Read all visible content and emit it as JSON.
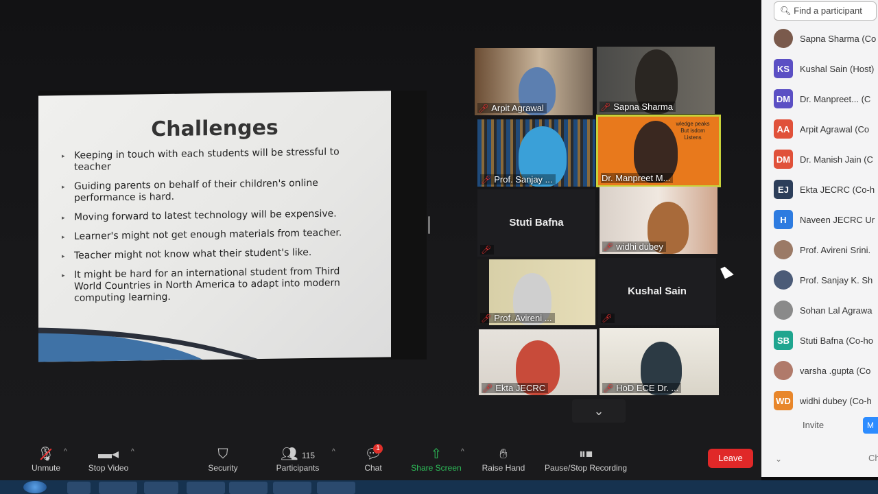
{
  "slide": {
    "title": "Challenges",
    "bullets": [
      "Keeping in touch with each students will be stressful to teacher",
      "Guiding parents on behalf of their children's online performance is hard.",
      "Moving forward to latest technology will be expensive.",
      "Learner's might not get enough materials from teacher.",
      "Teacher might not know what their student's like.",
      "It might be hard for an international student from Third World Countries in North America to adapt into modern computing learning."
    ]
  },
  "tiles": [
    {
      "name": "Arpit Agrawal",
      "video": true
    },
    {
      "name": "Sapna Sharma",
      "video": true
    },
    {
      "name": "Prof. Sanjay ...",
      "video": true
    },
    {
      "name": "Dr. Manpreet M...",
      "video": true,
      "active": true,
      "bg_text": "wledge peaks But isdom Listens"
    },
    {
      "name": "Stuti Bafna",
      "video": false
    },
    {
      "name": "widhi dubey",
      "video": true
    },
    {
      "name": "Prof. Avireni ...",
      "video": true
    },
    {
      "name": "Kushal Sain",
      "video": false
    },
    {
      "name": "Ekta JECRC",
      "video": true
    },
    {
      "name": "HoD ECE Dr. ...",
      "video": true
    }
  ],
  "panel": {
    "search_placeholder": "Find a participant",
    "participants": [
      {
        "initials": "",
        "name": "Sapna Sharma (Co",
        "color": "#7a5a4c",
        "photo": true
      },
      {
        "initials": "KS",
        "name": "Kushal Sain (Host)",
        "color": "#5b4fc4"
      },
      {
        "initials": "DM",
        "name": "Dr. Manpreet... (C",
        "color": "#5b4fc4"
      },
      {
        "initials": "AA",
        "name": "Arpit Agrawal (Co",
        "color": "#e0513a"
      },
      {
        "initials": "DM",
        "name": "Dr. Manish Jain (C",
        "color": "#e0513a"
      },
      {
        "initials": "EJ",
        "name": "Ekta JECRC (Co-h",
        "color": "#2c3e5a"
      },
      {
        "initials": "H",
        "name": "Naveen JECRC Ur",
        "color": "#2d7be0"
      },
      {
        "initials": "",
        "name": "Prof. Avireni Srini.",
        "color": "#9b7a66",
        "photo": true
      },
      {
        "initials": "",
        "name": "Prof. Sanjay K. Sh",
        "color": "#4b5b77",
        "photo": true
      },
      {
        "initials": "",
        "name": "Sohan Lal Agrawa",
        "color": "#8a8a8a",
        "photo": true
      },
      {
        "initials": "SB",
        "name": "Stuti Bafna (Co-ho",
        "color": "#1fa58f"
      },
      {
        "initials": "",
        "name": "varsha .gupta (Co",
        "color": "#b07a6a",
        "photo": true
      },
      {
        "initials": "WD",
        "name": "widhi dubey (Co-h",
        "color": "#e8862a"
      }
    ],
    "invite_label": "Invite",
    "invite_more": "M",
    "bottom_right": "Ch"
  },
  "toolbar": {
    "unmute": "Unmute",
    "stop_video": "Stop Video",
    "security": "Security",
    "participants": "Participants",
    "participants_count": "115",
    "chat": "Chat",
    "chat_badge": "1",
    "share_screen": "Share Screen",
    "raise_hand": "Raise Hand",
    "recording": "Pause/Stop Recording",
    "leave": "Leave"
  }
}
